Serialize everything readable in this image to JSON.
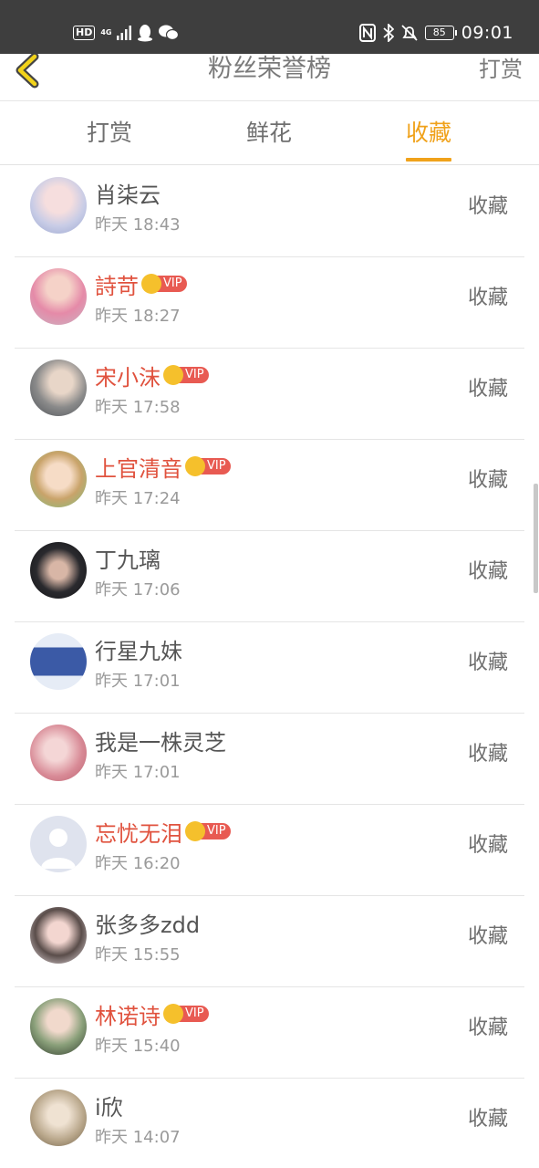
{
  "status_bar": {
    "hd": "HD",
    "network": "4G",
    "battery": "85",
    "time": "09:01"
  },
  "header": {
    "title": "粉丝荣誉榜",
    "right_action": "打赏"
  },
  "tabs": [
    {
      "label": "打赏",
      "active": false
    },
    {
      "label": "鲜花",
      "active": false
    },
    {
      "label": "收藏",
      "active": true
    }
  ],
  "list": [
    {
      "name": "肖柒云",
      "vip": false,
      "time": "昨天 18:43",
      "action": "收藏"
    },
    {
      "name": "詩苛",
      "vip": true,
      "time": "昨天 18:27",
      "action": "收藏"
    },
    {
      "name": "宋小沫",
      "vip": true,
      "time": "昨天 17:58",
      "action": "收藏"
    },
    {
      "name": "上官清音",
      "vip": true,
      "time": "昨天 17:24",
      "action": "收藏"
    },
    {
      "name": "丁九璃",
      "vip": false,
      "time": "昨天 17:06",
      "action": "收藏"
    },
    {
      "name": "行星九妹",
      "vip": false,
      "time": "昨天 17:01",
      "action": "收藏"
    },
    {
      "name": "我是一株灵芝",
      "vip": false,
      "time": "昨天 17:01",
      "action": "收藏"
    },
    {
      "name": "忘忧无泪",
      "vip": true,
      "time": "昨天 16:20",
      "action": "收藏"
    },
    {
      "name": "张多多zdd",
      "vip": false,
      "time": "昨天 15:55",
      "action": "收藏"
    },
    {
      "name": "林诺诗",
      "vip": true,
      "time": "昨天 15:40",
      "action": "收藏"
    },
    {
      "name": "i欣",
      "vip": false,
      "time": "昨天 14:07",
      "action": "收藏"
    }
  ],
  "vip_label": "VIP",
  "colors": {
    "accent": "#f0a21b",
    "vip_name": "#e0523e",
    "vip_badge": "#e85a52",
    "status_bar": "#3e3e3e"
  }
}
